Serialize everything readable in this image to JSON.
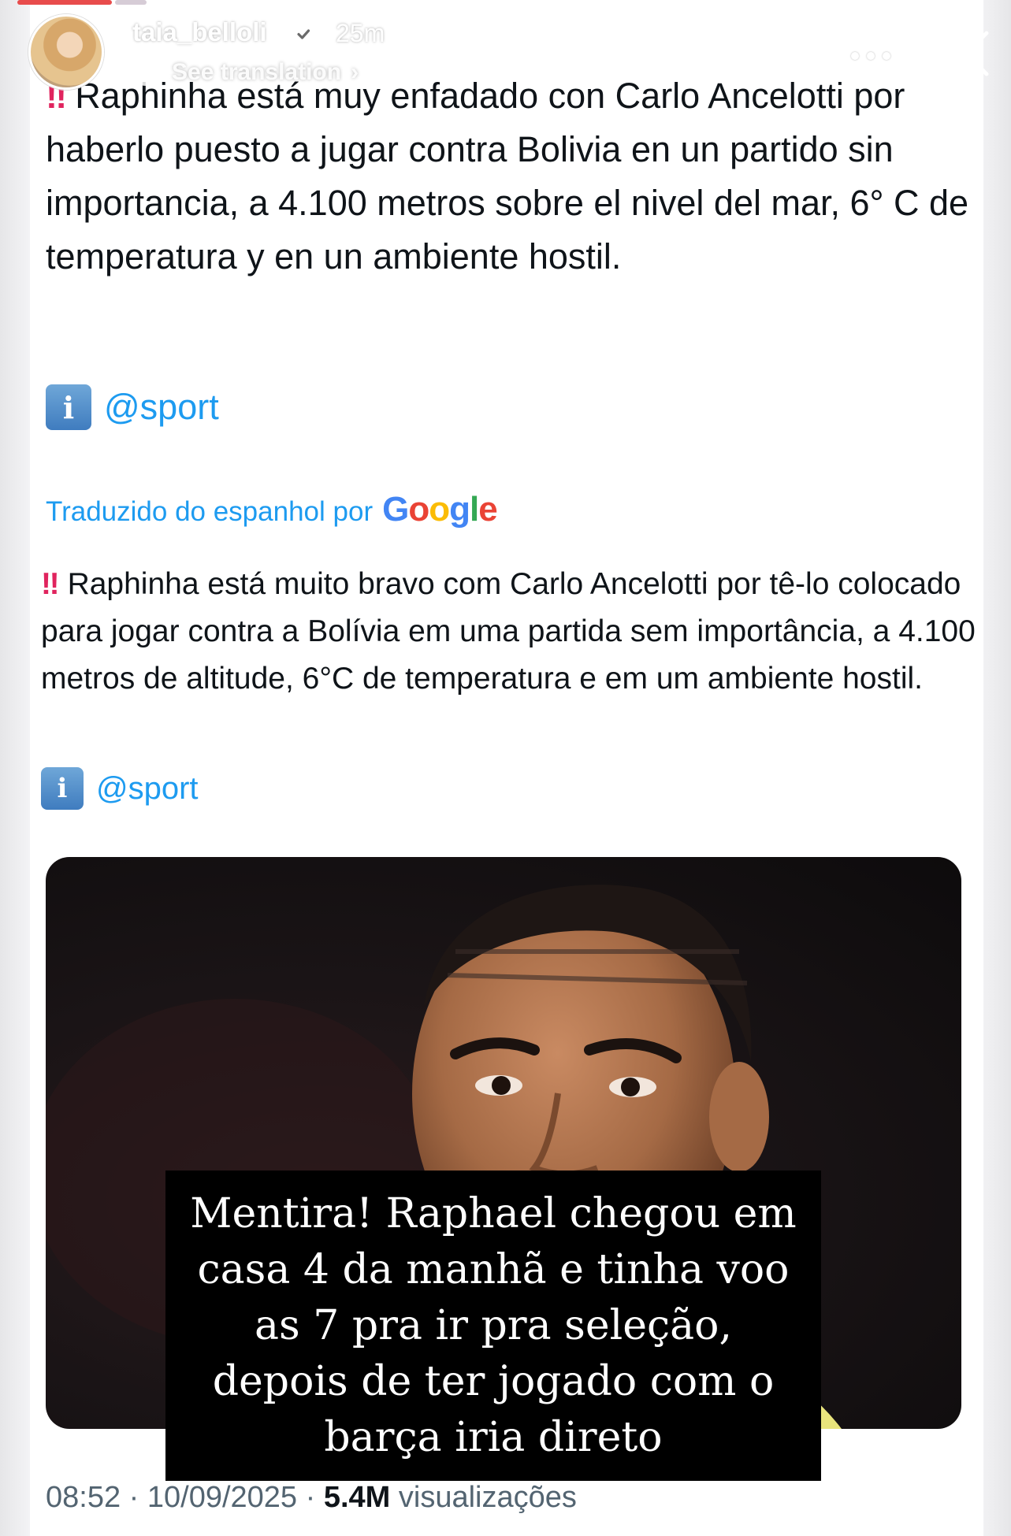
{
  "story": {
    "username": "taia_belloli",
    "time_ago": "25m",
    "translation_label": "See translation",
    "translation_chevron": "›",
    "icons": [
      "verified-icon",
      "more-icon",
      "close-icon",
      "translation-icon"
    ]
  },
  "tweet": {
    "original_text": "Raphinha está muy enfadado con Carlo Ancelotti por haberlo puesto a jugar contra Bolivia en un partido sin importancia, a 4.100 metros sobre el nivel del mar, 6° C de temperatura y en un ambiente hostil.",
    "bang": "‼",
    "info_glyph": "i",
    "mention": "@sport",
    "translated_by": "Traduzido do espanhol por",
    "google": "Google",
    "translated_text": "Raphinha está muito bravo com Carlo Ancelotti por tê-lo colocado para jogar contra a Bolívia em uma partida sem importância, a 4.100 metros de altitude, 6°C de temperatura e em um ambiente hostil.",
    "mention_translated": "@sport",
    "time": "08:52",
    "date": "10/09/2025",
    "views_count": "5.4M",
    "views_label": "visualizações",
    "separator": "·"
  },
  "caption": {
    "text": "Mentira! Raphael chegou em casa 4 da manhã e tinha voo as 7 pra ir pra seleção, depois de ter jogado com o barça iria direto"
  },
  "colors": {
    "link": "#1d9bf0",
    "alert": "#e0245e",
    "text": "#0f1419",
    "muted": "#536471"
  }
}
